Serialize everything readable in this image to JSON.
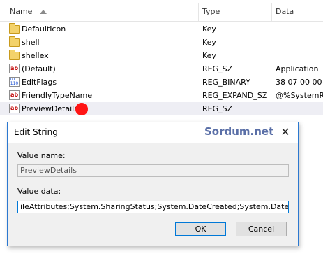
{
  "columns": {
    "name": "Name",
    "type": "Type",
    "data": "Data"
  },
  "rows": [
    {
      "icon": "folder-icon",
      "name": "DefaultIcon",
      "type": "Key",
      "data": ""
    },
    {
      "icon": "folder-icon",
      "name": "shell",
      "type": "Key",
      "data": ""
    },
    {
      "icon": "folder-icon",
      "name": "shellex",
      "type": "Key",
      "data": ""
    },
    {
      "icon": "reg-sz-icon",
      "name": "(Default)",
      "type": "REG_SZ",
      "data": "Application"
    },
    {
      "icon": "reg-binary-icon",
      "name": "EditFlags",
      "type": "REG_BINARY",
      "data": "38 07 00 00"
    },
    {
      "icon": "reg-sz-icon",
      "name": "FriendlyTypeName",
      "type": "REG_EXPAND_SZ",
      "data": "@%SystemRo"
    },
    {
      "icon": "reg-sz-icon",
      "name": "PreviewDetails",
      "type": "REG_SZ",
      "data": ""
    }
  ],
  "icon_text": {
    "sz": "ab",
    "binary": "011 110"
  },
  "dialog": {
    "title": "Edit String",
    "watermark": "Sordum.net",
    "close_glyph": "✕",
    "value_name_label": "Value name:",
    "value_name": "PreviewDetails",
    "value_data_label": "Value data:",
    "value_data": "ileAttributes;System.SharingStatus;System.DateCreated;System.DateModified",
    "ok_label": "OK",
    "cancel_label": "Cancel"
  },
  "colors": {
    "accent": "#0078d7",
    "marker": "#ff1515",
    "folder": "#f3d26b",
    "highlight_row": "#eeeef4"
  }
}
